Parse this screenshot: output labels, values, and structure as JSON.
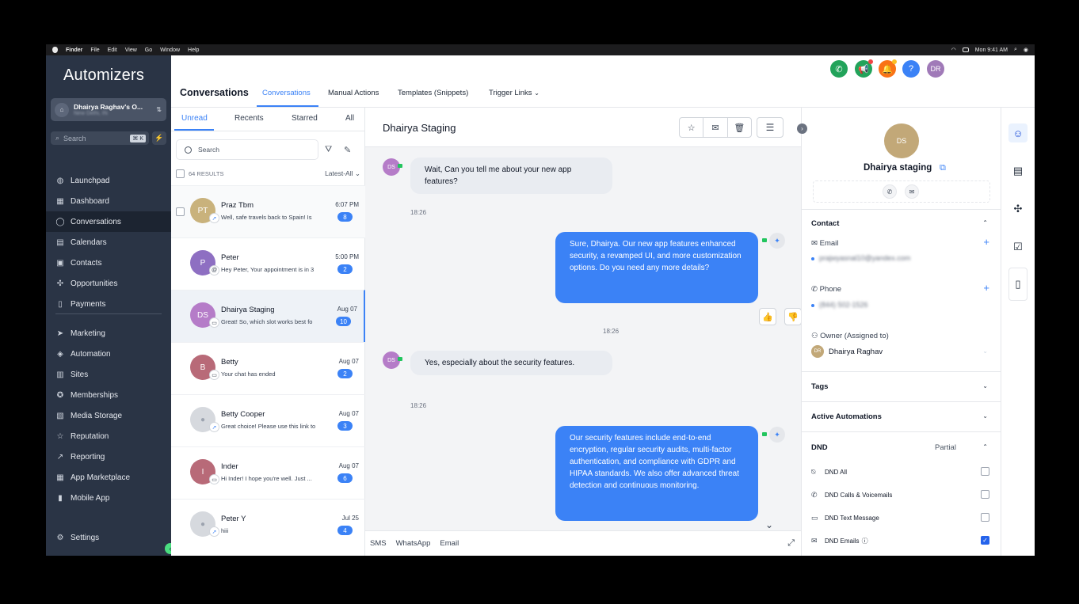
{
  "menubar": {
    "items": [
      "Finder",
      "File",
      "Edit",
      "View",
      "Go",
      "Window",
      "Help"
    ],
    "clock": "Mon 9:41 AM"
  },
  "sidebar": {
    "brand": "Automizers",
    "account_name": "Dhairya Raghav's O...",
    "account_sub": "New Delhi, IN",
    "search_placeholder": "Search",
    "search_shortcut": "⌘ K",
    "items": [
      {
        "label": "Launchpad"
      },
      {
        "label": "Dashboard"
      },
      {
        "label": "Conversations"
      },
      {
        "label": "Calendars"
      },
      {
        "label": "Contacts"
      },
      {
        "label": "Opportunities"
      },
      {
        "label": "Payments"
      },
      {
        "label": "Marketing"
      },
      {
        "label": "Automation"
      },
      {
        "label": "Sites"
      },
      {
        "label": "Memberships"
      },
      {
        "label": "Media Storage"
      },
      {
        "label": "Reputation"
      },
      {
        "label": "Reporting"
      },
      {
        "label": "App Marketplace"
      },
      {
        "label": "Mobile App"
      }
    ],
    "settings_label": "Settings"
  },
  "header": {
    "title": "Conversations",
    "tabs": [
      {
        "label": "Conversations"
      },
      {
        "label": "Manual Actions"
      },
      {
        "label": "Templates (Snippets)"
      },
      {
        "label": "Trigger Links"
      }
    ],
    "avatar_initials": "DR",
    "colors": {
      "phone": "#22a35a",
      "megaphone": "#22a35a",
      "bell": "#f97316",
      "help": "#3b82f6",
      "avatar": "#a07ab8"
    }
  },
  "conv_list": {
    "tabs": [
      {
        "label": "Unread"
      },
      {
        "label": "Recents"
      },
      {
        "label": "Starred"
      },
      {
        "label": "All"
      }
    ],
    "search_placeholder": "Search",
    "results": "64 RESULTS",
    "sort": "Latest-All",
    "items": [
      {
        "initials": "PT",
        "name": "Praz Tbm",
        "snippet": "Well, safe travels back to Spain! Is",
        "time": "6:07 PM",
        "count": "8",
        "color": "#c9b27c"
      },
      {
        "initials": "P",
        "name": "Peter",
        "snippet": "Hey Peter, Your appointment is in 3",
        "time": "5:00 PM",
        "count": "2",
        "color": "#8e6fc2"
      },
      {
        "initials": "DS",
        "name": "Dhairya Staging",
        "snippet": "Great! So, which slot works best fo",
        "time": "Aug 07",
        "count": "10",
        "color": "#b57cc8"
      },
      {
        "initials": "B",
        "name": "Betty",
        "snippet": "Your chat has ended",
        "time": "Aug 07",
        "count": "2",
        "color": "#b86a78"
      },
      {
        "initials": "",
        "name": "Betty Cooper",
        "snippet": "Great choice! Please use this link to",
        "time": "Aug 07",
        "count": "3",
        "color": "#d6d9de"
      },
      {
        "initials": "I",
        "name": "Inder",
        "snippet": "Hi Inder! I hope you're well. Just ...",
        "time": "Aug 07",
        "count": "6",
        "color": "#b86a78"
      },
      {
        "initials": "",
        "name": "Peter Y",
        "snippet": "hiii",
        "time": "Jul 25",
        "count": "4",
        "color": "#d6d9de"
      }
    ]
  },
  "chat": {
    "title": "Dhairya Staging",
    "messages": [
      {
        "dir": "in",
        "avatar": "DS",
        "text": "Wait, Can you tell me about your new app features?",
        "time": "18:26"
      },
      {
        "dir": "out",
        "text": "Sure, Dhairya. Our new app features enhanced security, a revamped UI, and more customization options. Do you need any more details?",
        "time": "18:26"
      },
      {
        "dir": "in",
        "avatar": "DS",
        "text": "Yes, especially about the security features.",
        "time": "18:26"
      },
      {
        "dir": "out",
        "text": "Our security features include end-to-end encryption, regular security audits, multi-factor authentication, and compliance with GDPR and HIPAA standards. We also offer advanced threat detection and continuous monitoring."
      }
    ],
    "composer_tabs": [
      "SMS",
      "WhatsApp",
      "Email"
    ]
  },
  "contact": {
    "initials": "DS",
    "name": "Dhairya staging",
    "section_contact": "Contact",
    "email_label": "Email",
    "email_value": "prajwyasnal10@yandex.com",
    "phone_label": "Phone",
    "phone_value": "(844) 502-1526",
    "owner_label": "Owner (Assigned to)",
    "owner_initials": "DR",
    "owner_name": "Dhairya Raghav",
    "tags": "Tags",
    "active_automations": "Active Automations",
    "dnd": "DND",
    "dnd_status": "Partial",
    "dnd_items": [
      {
        "label": "DND All",
        "checked": false
      },
      {
        "label": "DND Calls & Voicemails",
        "checked": false
      },
      {
        "label": "DND Text Message",
        "checked": false
      },
      {
        "label": "DND Emails",
        "checked": true
      }
    ]
  }
}
